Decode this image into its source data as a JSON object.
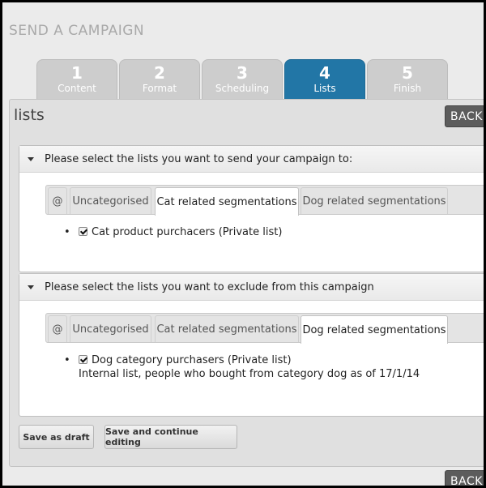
{
  "page": {
    "title": "SEND A CAMPAIGN"
  },
  "steps": [
    {
      "number": "1",
      "label": "Content",
      "active": false
    },
    {
      "number": "2",
      "label": "Format",
      "active": false
    },
    {
      "number": "3",
      "label": "Scheduling",
      "active": false
    },
    {
      "number": "4",
      "label": "Lists",
      "active": true
    },
    {
      "number": "5",
      "label": "Finish",
      "active": false
    }
  ],
  "panel": {
    "title": "lists",
    "back_label": "BACK"
  },
  "include": {
    "header": "Please select the lists you want to send your campaign to:",
    "tabs": [
      "@",
      "Uncategorised",
      "Cat related segmentations",
      "Dog related segmentations"
    ],
    "active_tab": "Cat related segmentations",
    "items": [
      {
        "label": "Cat product purchacers (Private list)",
        "checked": true
      }
    ]
  },
  "exclude": {
    "header": "Please select the lists you want to exclude from this campaign",
    "tabs": [
      "@",
      "Uncategorised",
      "Cat related segmentations",
      "Dog related segmentations"
    ],
    "active_tab": "Dog related segmentations",
    "items": [
      {
        "label": "Dog category purchasers (Private list)",
        "checked": true,
        "description": "Internal list, people who bought from category dog as of 17/1/14"
      }
    ]
  },
  "actions": {
    "save_draft_label": "Save as draft",
    "save_continue_label": "Save and continue editing"
  },
  "footer": {
    "back_label": "BACK"
  },
  "colors": {
    "active_step": "#2276a6",
    "inactive_step": "#cdcdcd",
    "back_button": "#5c5c5c",
    "panel_background": "#e0e0e0"
  }
}
